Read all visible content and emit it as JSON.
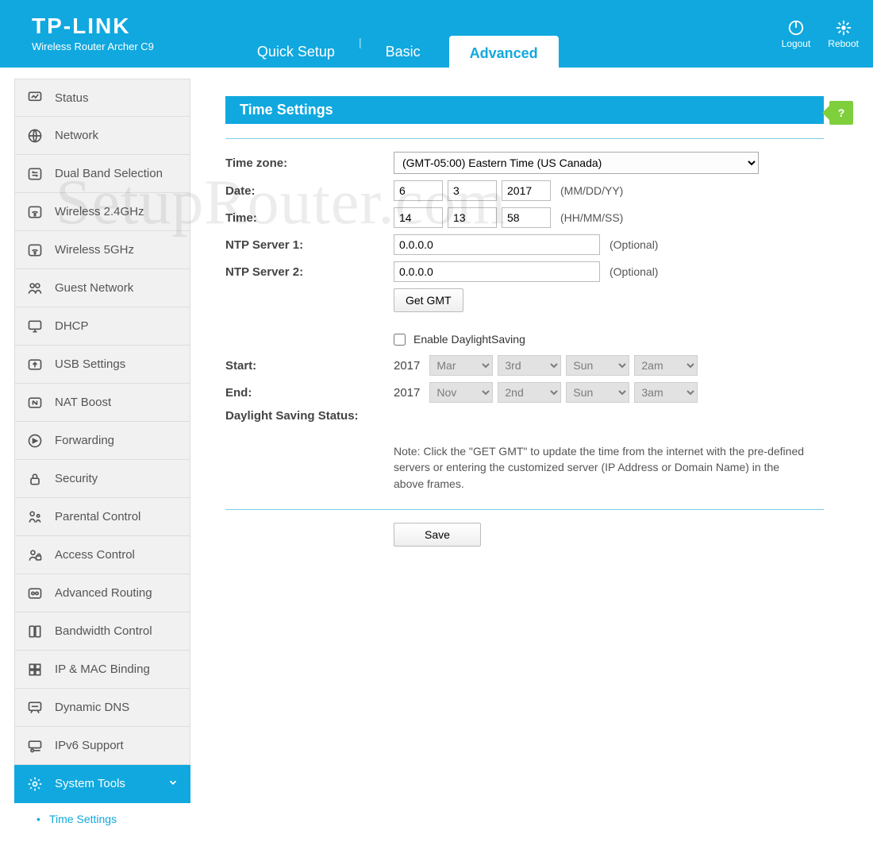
{
  "header": {
    "brand": "TP-LINK",
    "product": "Wireless Router Archer C9",
    "tabs": {
      "quick": "Quick Setup",
      "basic": "Basic",
      "advanced": "Advanced"
    },
    "logout": "Logout",
    "reboot": "Reboot"
  },
  "sidebar": {
    "items": [
      "Status",
      "Network",
      "Dual Band Selection",
      "Wireless 2.4GHz",
      "Wireless 5GHz",
      "Guest Network",
      "DHCP",
      "USB Settings",
      "NAT Boost",
      "Forwarding",
      "Security",
      "Parental Control",
      "Access Control",
      "Advanced Routing",
      "Bandwidth Control",
      "IP & MAC Binding",
      "Dynamic DNS",
      "IPv6 Support",
      "System Tools"
    ],
    "sub_active": "Time Settings"
  },
  "panel": {
    "title": "Time Settings",
    "labels": {
      "tz": "Time zone:",
      "date": "Date:",
      "time": "Time:",
      "ntp1": "NTP Server 1:",
      "ntp2": "NTP Server 2:",
      "start": "Start:",
      "end": "End:",
      "dss": "Daylight Saving Status:"
    },
    "tz_value": "(GMT-05:00) Eastern Time (US Canada)",
    "date": {
      "mm": "6",
      "dd": "3",
      "yy": "2017",
      "hint": "(MM/DD/YY)"
    },
    "time": {
      "hh": "14",
      "mm": "13",
      "ss": "58",
      "hint": "(HH/MM/SS)"
    },
    "ntp1": "0.0.0.0",
    "ntp2": "0.0.0.0",
    "optional": "(Optional)",
    "btn_getgmt": "Get GMT",
    "dst_enable": "Enable DaylightSaving",
    "start": {
      "year": "2017",
      "mon": "Mar",
      "wk": "3rd",
      "day": "Sun",
      "hr": "2am"
    },
    "end": {
      "year": "2017",
      "mon": "Nov",
      "wk": "2nd",
      "day": "Sun",
      "hr": "3am"
    },
    "note": "Note: Click the \"GET GMT\" to update the time from the internet with the pre-defined servers or entering the customized server (IP Address or Domain Name) in the above frames.",
    "btn_save": "Save"
  },
  "watermark": "SetupRouter.com"
}
